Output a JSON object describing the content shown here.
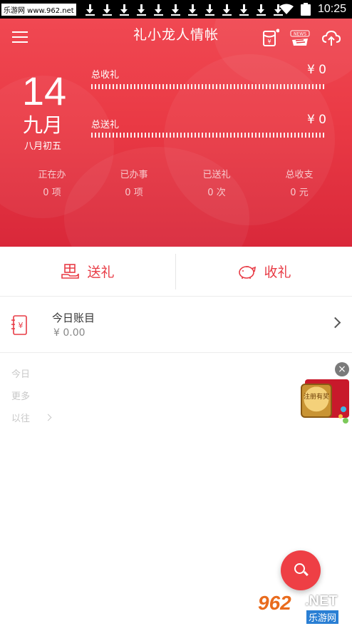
{
  "statusbar": {
    "badge": "乐游网 www.962.net",
    "download_count": 12,
    "time": "10:25"
  },
  "header": {
    "title": "礼小龙人情帐",
    "news_icon_text": "NEWS\n头条"
  },
  "date": {
    "day": "14",
    "month": "九月",
    "lunar": "八月初五"
  },
  "totals": {
    "received_label": "总收礼",
    "received_value": "¥ 0",
    "sent_label": "总送礼",
    "sent_value": "¥ 0"
  },
  "stats": [
    {
      "label": "正在办",
      "value": "0 项"
    },
    {
      "label": "已办事",
      "value": "0 项"
    },
    {
      "label": "已送礼",
      "value": "0 次"
    },
    {
      "label": "总收支",
      "value": "0 元"
    }
  ],
  "actions": {
    "send_label": "送礼",
    "receive_label": "收礼"
  },
  "ledger": {
    "title": "今日账目",
    "amount": "¥ 0.00"
  },
  "list": {
    "today": "今日",
    "more": "更多",
    "past": "以往"
  },
  "promo": {
    "text": "注册有奖",
    "close": "×"
  },
  "watermark": {
    "num": "962",
    "net": ".NET",
    "cn": "乐游网"
  },
  "colors": {
    "accent": "#e83b45",
    "header_red": "#ea3a45"
  }
}
